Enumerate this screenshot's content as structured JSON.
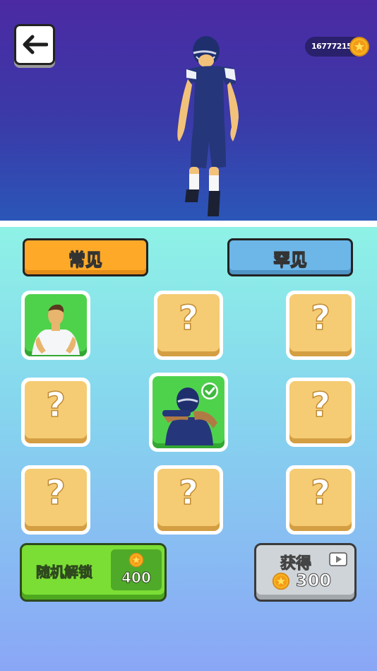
{
  "header": {
    "back_icon": "arrow-left-icon",
    "coin_balance": "16777215",
    "coin_icon": "coin-star-icon"
  },
  "tabs": [
    {
      "label": "常见",
      "active": true,
      "color": "#ffa928"
    },
    {
      "label": "罕见",
      "active": false,
      "color": "#6cb6e8"
    }
  ],
  "grid": {
    "locked_mark": "?",
    "slots": [
      {
        "state": "unlocked",
        "character": "white-shirt-man"
      },
      {
        "state": "locked"
      },
      {
        "state": "locked"
      },
      {
        "state": "locked"
      },
      {
        "state": "selected",
        "character": "football-player-dab"
      },
      {
        "state": "locked"
      },
      {
        "state": "locked"
      },
      {
        "state": "locked"
      },
      {
        "state": "locked"
      }
    ]
  },
  "random_unlock": {
    "label": "随机解锁",
    "price": "400",
    "color": "#7bde34"
  },
  "earn": {
    "label": "获得",
    "amount": "300",
    "icon": "video-play-icon"
  }
}
